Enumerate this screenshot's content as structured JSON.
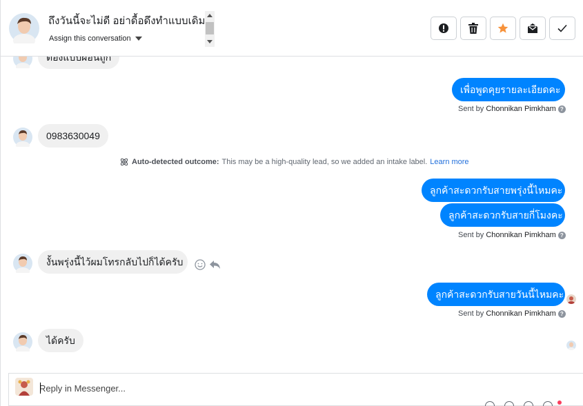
{
  "header": {
    "title": "ถึงวันนี้จะไม่ดี อย่าดื้อดึงทำแบบเดิม",
    "assign_label": "Assign this conversation",
    "actions": [
      "mark-spam",
      "delete",
      "star",
      "mark-unread",
      "mark-done"
    ]
  },
  "thread": {
    "top_partial_message": "ต้องแบบผ่อนถูก",
    "outgoing_1": "เพื่อพูดคุยรายละเอียดคะ",
    "sent_by_prefix": "Sent by",
    "agent_name": "Chonnikan Pimkham",
    "incoming_phone": "0983630049",
    "outcome_label": "Auto-detected outcome:",
    "outcome_text": "This may be a high-quality lead, so we added an intake label.",
    "outcome_link": "Learn more",
    "outgoing_2a": "ลูกค้าสะดวกรับสายพรุ่งนี้ไหมคะ",
    "outgoing_2b": "ลูกค้าสะดวกรับสายกี่โมงคะ",
    "incoming_callback": "งั้นพรุ่งนี้ไว้ผมโทรกลับไปก็ได้ครับ",
    "outgoing_3": "ลูกค้าสะดวกรับสายวันนี้ไหมคะ",
    "incoming_ok": "ได้ครับ"
  },
  "reply": {
    "placeholder": "Reply in Messenger..."
  },
  "colors": {
    "accent": "#0084ff",
    "incoming_bubble": "#f0f0f0",
    "star": "#f7923b",
    "link": "#216fdb"
  }
}
